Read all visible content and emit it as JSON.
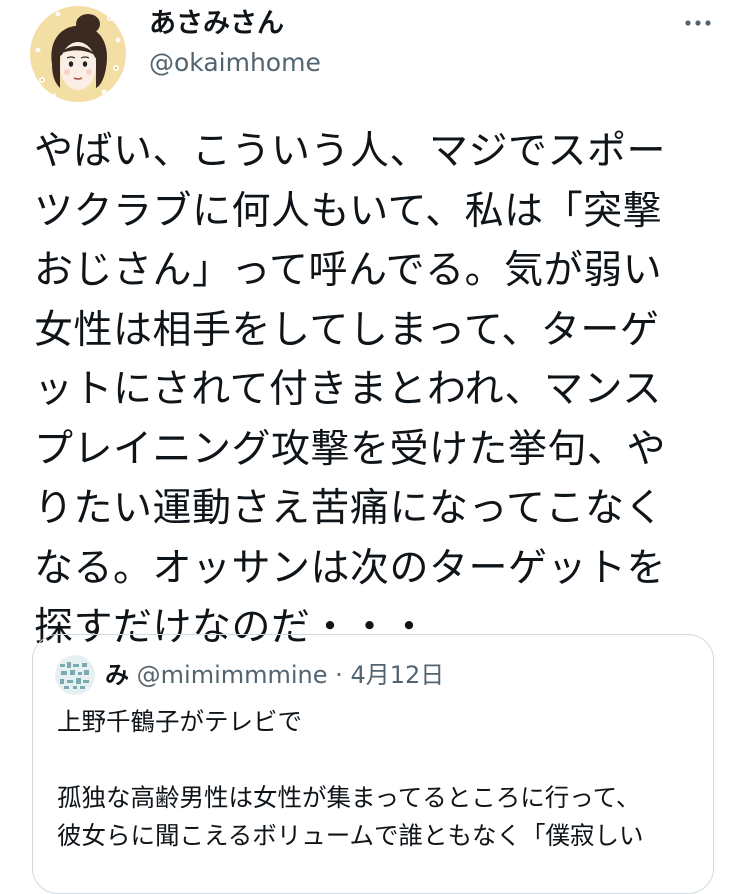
{
  "tweet": {
    "author": {
      "display_name": "あさみさん",
      "handle": "@okaimhome"
    },
    "more_icon": "more-horizontal-icon",
    "text_lines": [
      "やばい、こういう人、マジでスポー",
      "ツクラブに何人もいて、私は「突撃",
      "おじさん」って呼んでる。気が弱い",
      "女性は相手をしてしまって、ターゲ",
      "ットにされて付きまとわれ、マンス",
      "プレイニング攻撃を受けた挙句、や",
      "りたい運動さえ苦痛になってこなく",
      "なる。オッサンは次のターゲットを",
      "探すだけなのだ・・・"
    ]
  },
  "quoted_tweet": {
    "display_name": "み",
    "handle": "@mimimmmine",
    "separator": "·",
    "date": "4月12日",
    "text_lines": [
      "上野千鶴子がテレビで",
      "",
      "孤独な高齢男性は女性が集まってるところに行って、",
      "彼女らに聞こえるボリュームで誰ともなく「僕寂しい"
    ]
  },
  "colors": {
    "text_primary": "#0f1419",
    "text_secondary": "#536471",
    "border": "#cfd9de",
    "avatar_bg": "#f3dfa3"
  }
}
